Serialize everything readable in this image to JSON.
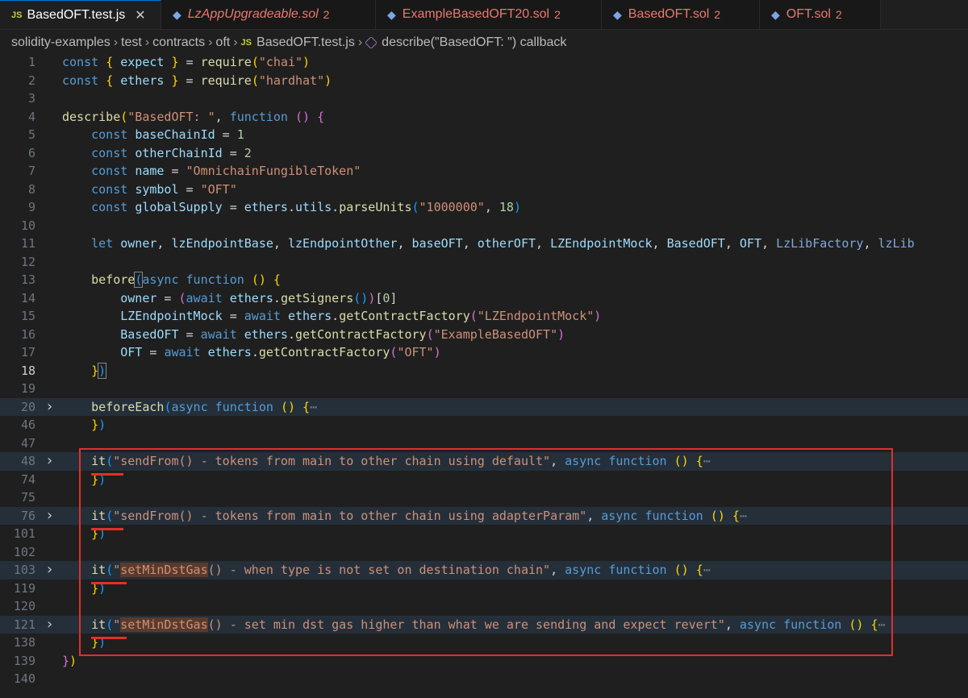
{
  "tabs": [
    {
      "label": "BasedOFT.test.js",
      "kind": "js",
      "active": true
    },
    {
      "label": "LzAppUpgradeable.sol",
      "kind": "sol",
      "count": "2",
      "italic": true
    },
    {
      "label": "ExampleBasedOFT20.sol",
      "kind": "sol",
      "count": "2"
    },
    {
      "label": "BasedOFT.sol",
      "kind": "sol",
      "count": "2"
    },
    {
      "label": "OFT.sol",
      "kind": "sol",
      "count": "2"
    }
  ],
  "breadcrumb": [
    "solidity-examples",
    "test",
    "contracts",
    "oft",
    "BasedOFT.test.js",
    "describe(\"BasedOFT: \") callback"
  ],
  "current_line": "18",
  "lines": [
    {
      "n": "1",
      "html": "<span class=\"k\">const</span> <span class=\"p1\">{</span> <span class=\"v\">expect</span> <span class=\"p1\">}</span> = <span class=\"f\">require</span><span class=\"p1\">(</span><span class=\"s\">\"chai\"</span><span class=\"p1\">)</span>"
    },
    {
      "n": "2",
      "html": "<span class=\"k\">const</span> <span class=\"p1\">{</span> <span class=\"v\">ethers</span> <span class=\"p1\">}</span> = <span class=\"f\">require</span><span class=\"p1\">(</span><span class=\"s\">\"hardhat\"</span><span class=\"p1\">)</span>"
    },
    {
      "n": "3",
      "html": ""
    },
    {
      "n": "4",
      "html": "<span class=\"f\">describe</span><span class=\"p1\">(</span><span class=\"s\">\"BasedOFT: \"</span>, <span class=\"k\">function</span> <span class=\"p2\">()</span> <span class=\"p2\">{</span>"
    },
    {
      "n": "5",
      "html": "    <span class=\"k\">const</span> <span class=\"v\">baseChainId</span> = <span class=\"n\">1</span>"
    },
    {
      "n": "6",
      "html": "    <span class=\"k\">const</span> <span class=\"v\">otherChainId</span> = <span class=\"n\">2</span>"
    },
    {
      "n": "7",
      "html": "    <span class=\"k\">const</span> <span class=\"v\">name</span> = <span class=\"s\">\"OmnichainFungibleToken\"</span>"
    },
    {
      "n": "8",
      "html": "    <span class=\"k\">const</span> <span class=\"v\">symbol</span> = <span class=\"s\">\"OFT\"</span>"
    },
    {
      "n": "9",
      "html": "    <span class=\"k\">const</span> <span class=\"v\">globalSupply</span> = <span class=\"v\">ethers</span>.<span class=\"v\">utils</span>.<span class=\"f\">parseUnits</span><span class=\"p3\">(</span><span class=\"s\">\"1000000\"</span>, <span class=\"n\">18</span><span class=\"p3\">)</span>"
    },
    {
      "n": "10",
      "html": ""
    },
    {
      "n": "11",
      "html": "    <span class=\"k\">let</span> <span class=\"v\">owner</span>, <span class=\"v\">lzEndpointBase</span>, <span class=\"v\">lzEndpointOther</span>, <span class=\"v\">baseOFT</span>, <span class=\"v\">otherOFT</span>, <span class=\"v\">LZEndpointMock</span>, <span class=\"v\">BasedOFT</span>, <span class=\"v\">OFT</span>, <span class=\"v\" style=\"color:#7fa7d9\">LzLibFactory</span>, <span class=\"v\" style=\"color:#7fa7d9\">lzLib</span>"
    },
    {
      "n": "12",
      "html": ""
    },
    {
      "n": "13",
      "html": "    <span class=\"f\">before</span><span class=\"p3 bracketbox\">(</span><span class=\"k\">async</span> <span class=\"k\">function</span> <span class=\"p1\">()</span> <span class=\"p1\">{</span>"
    },
    {
      "n": "14",
      "html": "        <span class=\"v\">owner</span> = <span class=\"p2\">(</span><span class=\"k\">await</span> <span class=\"v\">ethers</span>.<span class=\"f\">getSigners</span><span class=\"p3\">()</span><span class=\"p2\">)</span>[<span class=\"n\">0</span>]"
    },
    {
      "n": "15",
      "html": "        <span class=\"v\">LZEndpointMock</span> = <span class=\"k\">await</span> <span class=\"v\">ethers</span>.<span class=\"f\">getContractFactory</span><span class=\"p2\">(</span><span class=\"s\">\"LZEndpointMock\"</span><span class=\"p2\">)</span>"
    },
    {
      "n": "16",
      "html": "        <span class=\"v\">BasedOFT</span> = <span class=\"k\">await</span> <span class=\"v\">ethers</span>.<span class=\"f\">getContractFactory</span><span class=\"p2\">(</span><span class=\"s\">\"ExampleBasedOFT\"</span><span class=\"p2\">)</span>"
    },
    {
      "n": "17",
      "html": "        <span class=\"v\">OFT</span> = <span class=\"k\">await</span> <span class=\"v\">ethers</span>.<span class=\"f\">getContractFactory</span><span class=\"p2\">(</span><span class=\"s\">\"OFT\"</span><span class=\"p2\">)</span>"
    },
    {
      "n": "18",
      "html": "    <span class=\"p1\">}</span><span class=\"p3 bracketbox\">)</span>"
    },
    {
      "n": "19",
      "html": ""
    },
    {
      "n": "20",
      "fold": true,
      "hl": true,
      "html": "    <span class=\"f\">beforeEach</span><span class=\"p3\">(</span><span class=\"k\">async</span> <span class=\"k\">function</span> <span class=\"p1\">()</span> <span class=\"p1\">{</span><span class=\"dim\">⋯</span>"
    },
    {
      "n": "46",
      "html": "    <span class=\"p1\">}</span><span class=\"p3\">)</span>"
    },
    {
      "n": "47",
      "html": ""
    },
    {
      "n": "48",
      "fold": true,
      "hl": true,
      "html": "    <span class=\"f\">it</span><span class=\"p3\">(</span><span class=\"s\">\"sendFrom() - tokens from main to other chain using default\"</span>, <span class=\"k\">async</span> <span class=\"k\">function</span> <span class=\"p1\">()</span> <span class=\"p1\">{</span><span class=\"dim\">⋯</span>"
    },
    {
      "n": "74",
      "html": "    <span class=\"p1\">}</span><span class=\"p3\">)</span>"
    },
    {
      "n": "75",
      "html": ""
    },
    {
      "n": "76",
      "fold": true,
      "hl": true,
      "html": "    <span class=\"f\">it</span><span class=\"p3\">(</span><span class=\"s\">\"sendFrom() - tokens from main to other chain using adapterParam\"</span>, <span class=\"k\">async</span> <span class=\"k\">function</span> <span class=\"p1\">()</span> <span class=\"p1\">{</span><span class=\"dim\">⋯</span>"
    },
    {
      "n": "101",
      "html": "    <span class=\"p1\">}</span><span class=\"p3\">)</span>"
    },
    {
      "n": "102",
      "html": ""
    },
    {
      "n": "103",
      "fold": true,
      "hl": true,
      "html": "    <span class=\"f\">it</span><span class=\"p3\">(</span><span class=\"s\">\"<span class=\"match\">setMinDstGas</span>() - when type is not set on destination chain\"</span>, <span class=\"k\">async</span> <span class=\"k\">function</span> <span class=\"p1\">()</span> <span class=\"p1\">{</span><span class=\"dim\">⋯</span>"
    },
    {
      "n": "119",
      "html": "    <span class=\"p1\">}</span><span class=\"p3\">)</span>"
    },
    {
      "n": "120",
      "html": ""
    },
    {
      "n": "121",
      "fold": true,
      "hl": true,
      "html": "    <span class=\"f\">it</span><span class=\"p3\">(</span><span class=\"s\">\"<span class=\"match\">setMinDstGas</span>() - set min dst gas higher than what we are sending and expect revert\"</span>, <span class=\"k\">async</span> <span class=\"k\">function</span> <span class=\"p1\">()</span> <span class=\"p1\">{</span><span class=\"dim\">⋯</span>"
    },
    {
      "n": "138",
      "html": "    <span class=\"p1\">}</span><span class=\"p3\">)</span>"
    },
    {
      "n": "139",
      "html": "<span class=\"p2\">}</span><span class=\"p1\">)</span>"
    },
    {
      "n": "140",
      "html": ""
    }
  ],
  "colors": {
    "annotation": "#e0302a",
    "background": "#1f1f1f"
  }
}
